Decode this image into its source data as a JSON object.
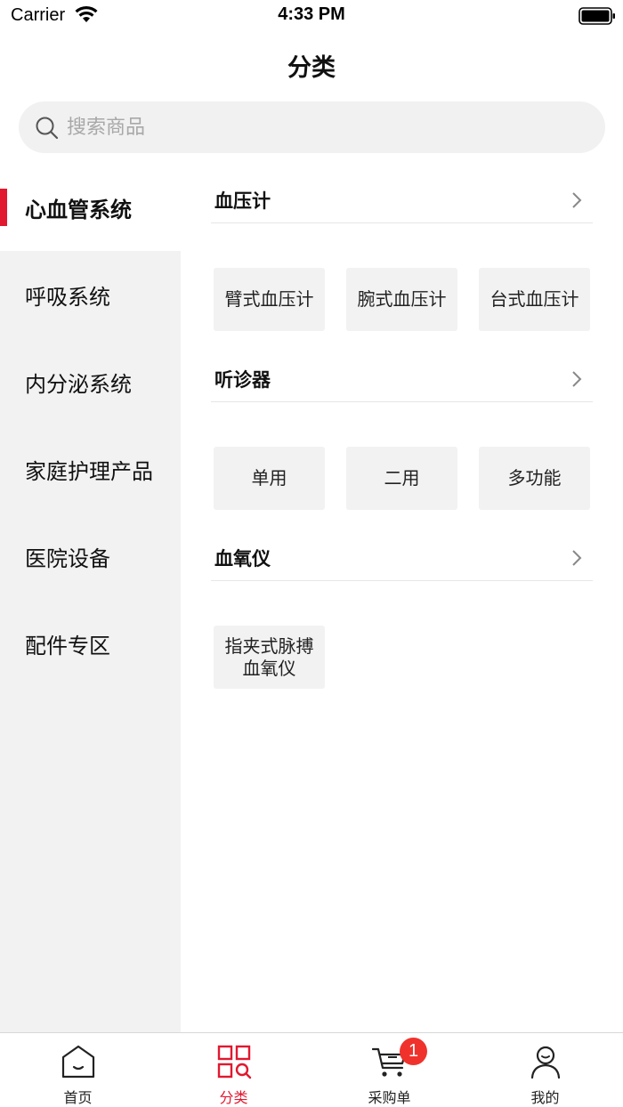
{
  "status_bar": {
    "carrier": "Carrier",
    "time": "4:33 PM"
  },
  "nav": {
    "title": "分类"
  },
  "search": {
    "placeholder": "搜索商品",
    "value": ""
  },
  "sidebar": {
    "items": [
      {
        "label": "心血管系统",
        "active": true
      },
      {
        "label": "呼吸系统"
      },
      {
        "label": "内分泌系统"
      },
      {
        "label": "家庭护理产品"
      },
      {
        "label": "医院设备"
      },
      {
        "label": "配件专区"
      }
    ]
  },
  "content": {
    "sections": [
      {
        "title": "血压计",
        "chips": [
          "臂式血压计",
          "腕式血压计",
          "台式血压计"
        ]
      },
      {
        "title": "听诊器",
        "chips": [
          "单用",
          "二用",
          "多功能"
        ]
      },
      {
        "title": "血氧仪",
        "chips": [
          "指夹式脉搏血氧仪"
        ]
      }
    ]
  },
  "tab_bar": {
    "tabs": [
      {
        "label": "首页",
        "icon": "home-icon"
      },
      {
        "label": "分类",
        "icon": "category-icon",
        "active": true
      },
      {
        "label": "采购单",
        "icon": "cart-icon",
        "badge": "1"
      },
      {
        "label": "我的",
        "icon": "profile-icon"
      }
    ]
  },
  "colors": {
    "accent": "#e1182f",
    "sidebar_bg": "#f2f2f2",
    "chip_bg": "#f2f2f2",
    "badge": "#f0322d"
  }
}
